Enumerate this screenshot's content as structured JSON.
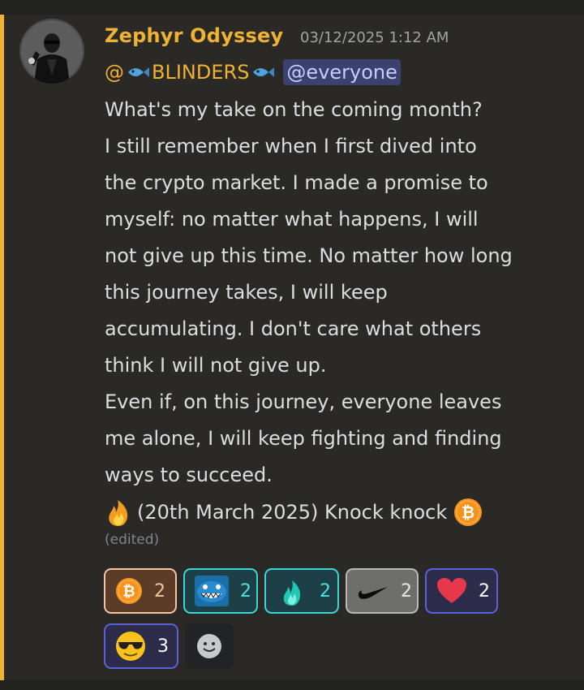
{
  "message": {
    "username": "Zephyr Odyssey",
    "timestamp": "03/12/2025 1:12 AM",
    "mention_user": "@🐟BLINDERS🐟",
    "mention_user_text": "BLINDERS",
    "mention_everyone": "@everyone",
    "lines": [
      "What's my take on the coming month?",
      "I still remember when I first dived into",
      "the crypto market. I made a promise to",
      "myself: no matter what happens, I will",
      "not give up this time. No matter how long",
      "this journey takes, I will keep",
      "accumulating. I don't care what others",
      "think I will not give up.",
      "Even if, on this journey, everyone leaves",
      "me alone, I will keep fighting and finding",
      "ways to succeed."
    ],
    "last_line": "(20th March 2025) Knock knock",
    "edited_label": "(edited)"
  },
  "reactions": [
    {
      "icon": "bitcoin-icon",
      "count": "2",
      "selected": true
    },
    {
      "icon": "shark-emoji-icon",
      "count": "2",
      "selected": true
    },
    {
      "icon": "blue-fire-icon",
      "count": "2",
      "selected": true
    },
    {
      "icon": "nike-swoosh-icon",
      "count": "2",
      "selected": false
    },
    {
      "icon": "heart-icon",
      "count": "2",
      "selected": true
    },
    {
      "icon": "sunglasses-face-icon",
      "count": "3",
      "selected": true
    }
  ],
  "colors": {
    "background": "#2a2926",
    "username": "#f0b232",
    "text": "#dbdee1",
    "timestamp": "#a0a3a8",
    "mention_bg": "#3c4270",
    "mention_text": "#c9cdfb",
    "accent_bar": "#f0b232"
  }
}
